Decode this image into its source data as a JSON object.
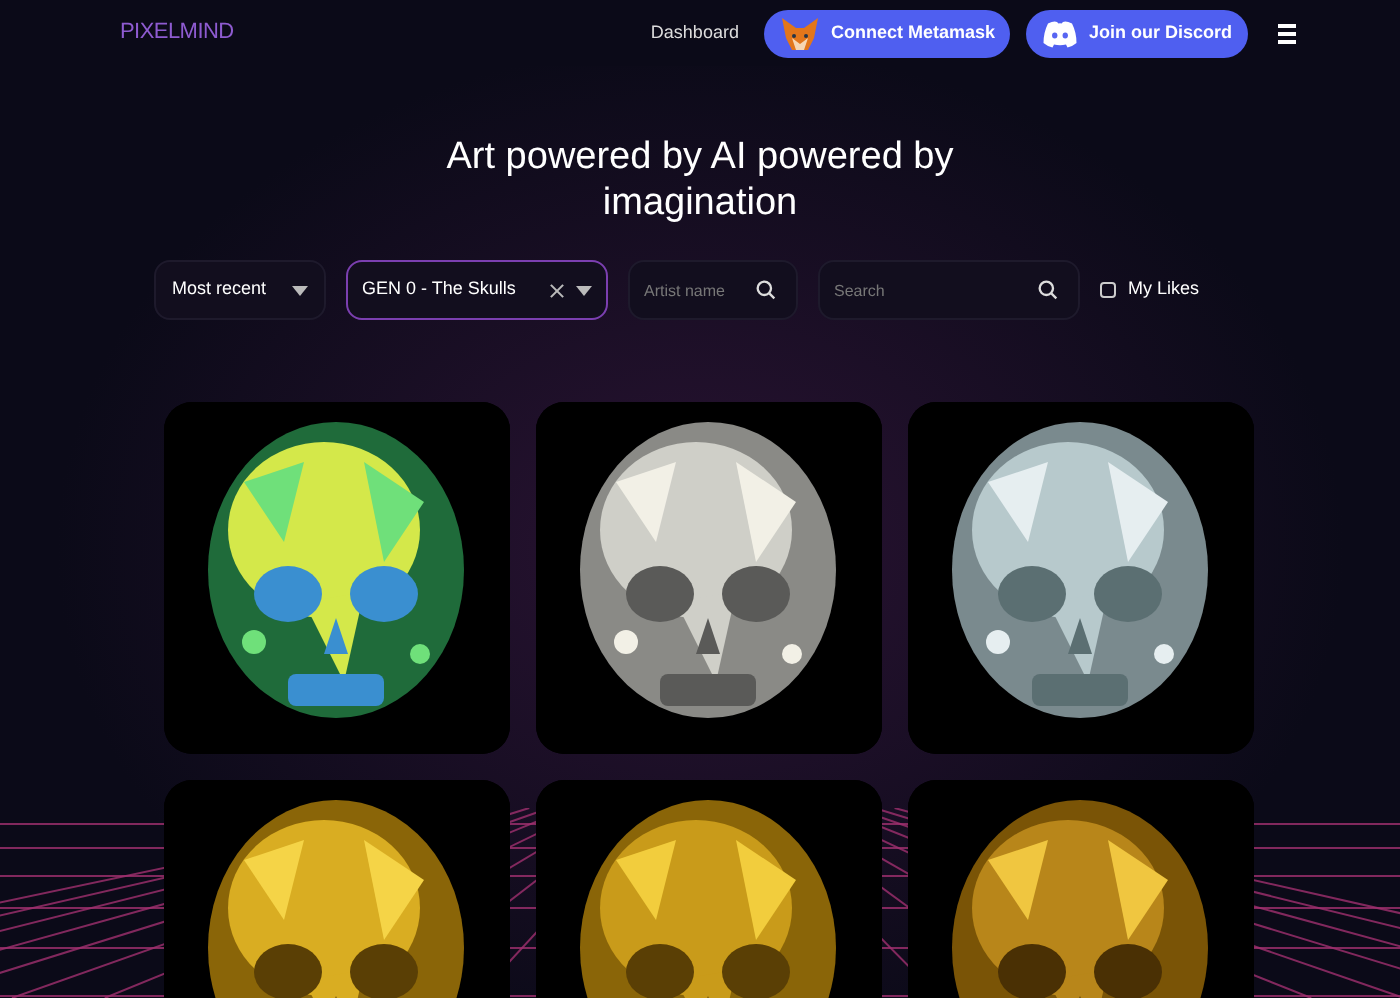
{
  "navbar": {
    "logo": "PIXELMIND",
    "links": [
      "Dashboard"
    ],
    "buttons": [
      {
        "kind": "metamask",
        "label": "Connect Metamask"
      },
      {
        "kind": "discord",
        "label": "Join our Discord"
      }
    ]
  },
  "headline": "Art powered by AI powered by imagination",
  "filters": {
    "sort": {
      "value": "Most recent"
    },
    "collection": {
      "value": "GEN 0 - The Skulls"
    },
    "artist": {
      "placeholder": "Artist name"
    },
    "search": {
      "placeholder": "Search"
    },
    "my_likes": {
      "label": "My Likes",
      "checked": false
    }
  }
}
